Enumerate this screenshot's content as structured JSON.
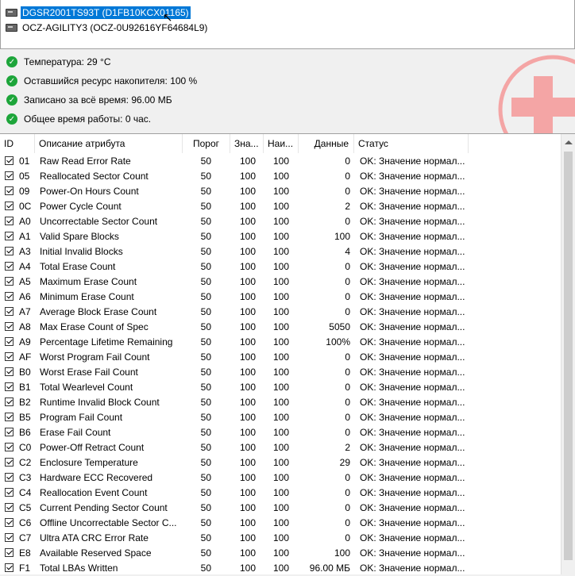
{
  "drives": [
    {
      "label": "DGSR2001TS93T (D1FB10KCX01165)",
      "selected": true
    },
    {
      "label": "OCZ-AGILITY3 (OCZ-0U92616YF64684L9)",
      "selected": false
    }
  ],
  "summary": [
    {
      "label": "Температура: 29 °C"
    },
    {
      "label": "Оставшийся ресурс накопителя: 100 %"
    },
    {
      "label": "Записано за всё время: 96.00 МБ"
    },
    {
      "label": "Общее время работы: 0 час."
    }
  ],
  "table": {
    "columns": {
      "id": "ID",
      "description": "Описание атрибута",
      "threshold": "Порог",
      "value": "Зна...",
      "worst": "Наи...",
      "raw": "Данные",
      "status": "Статус"
    },
    "rows": [
      {
        "id": "01",
        "desc": "Raw Read Error Rate",
        "thr": "50",
        "val": "100",
        "worst": "100",
        "raw": "0",
        "status": "OK: Значение нормал..."
      },
      {
        "id": "05",
        "desc": "Reallocated Sector Count",
        "thr": "50",
        "val": "100",
        "worst": "100",
        "raw": "0",
        "status": "OK: Значение нормал..."
      },
      {
        "id": "09",
        "desc": "Power-On Hours Count",
        "thr": "50",
        "val": "100",
        "worst": "100",
        "raw": "0",
        "status": "OK: Значение нормал..."
      },
      {
        "id": "0C",
        "desc": "Power Cycle Count",
        "thr": "50",
        "val": "100",
        "worst": "100",
        "raw": "2",
        "status": "OK: Значение нормал..."
      },
      {
        "id": "A0",
        "desc": "Uncorrectable Sector Count",
        "thr": "50",
        "val": "100",
        "worst": "100",
        "raw": "0",
        "status": "OK: Значение нормал..."
      },
      {
        "id": "A1",
        "desc": "Valid Spare Blocks",
        "thr": "50",
        "val": "100",
        "worst": "100",
        "raw": "100",
        "status": "OK: Значение нормал..."
      },
      {
        "id": "A3",
        "desc": "Initial Invalid Blocks",
        "thr": "50",
        "val": "100",
        "worst": "100",
        "raw": "4",
        "status": "OK: Значение нормал..."
      },
      {
        "id": "A4",
        "desc": "Total Erase Count",
        "thr": "50",
        "val": "100",
        "worst": "100",
        "raw": "0",
        "status": "OK: Значение нормал..."
      },
      {
        "id": "A5",
        "desc": "Maximum Erase Count",
        "thr": "50",
        "val": "100",
        "worst": "100",
        "raw": "0",
        "status": "OK: Значение нормал..."
      },
      {
        "id": "A6",
        "desc": "Minimum Erase Count",
        "thr": "50",
        "val": "100",
        "worst": "100",
        "raw": "0",
        "status": "OK: Значение нормал..."
      },
      {
        "id": "A7",
        "desc": "Average Block Erase Count",
        "thr": "50",
        "val": "100",
        "worst": "100",
        "raw": "0",
        "status": "OK: Значение нормал..."
      },
      {
        "id": "A8",
        "desc": "Max Erase Count of Spec",
        "thr": "50",
        "val": "100",
        "worst": "100",
        "raw": "5050",
        "status": "OK: Значение нормал..."
      },
      {
        "id": "A9",
        "desc": "Percentage Lifetime Remaining",
        "thr": "50",
        "val": "100",
        "worst": "100",
        "raw": "100%",
        "status": "OK: Значение нормал..."
      },
      {
        "id": "AF",
        "desc": "Worst Program Fail Count",
        "thr": "50",
        "val": "100",
        "worst": "100",
        "raw": "0",
        "status": "OK: Значение нормал..."
      },
      {
        "id": "B0",
        "desc": "Worst Erase Fail Count",
        "thr": "50",
        "val": "100",
        "worst": "100",
        "raw": "0",
        "status": "OK: Значение нормал..."
      },
      {
        "id": "B1",
        "desc": "Total Wearlevel Count",
        "thr": "50",
        "val": "100",
        "worst": "100",
        "raw": "0",
        "status": "OK: Значение нормал..."
      },
      {
        "id": "B2",
        "desc": "Runtime Invalid Block Count",
        "thr": "50",
        "val": "100",
        "worst": "100",
        "raw": "0",
        "status": "OK: Значение нормал..."
      },
      {
        "id": "B5",
        "desc": "Program Fail Count",
        "thr": "50",
        "val": "100",
        "worst": "100",
        "raw": "0",
        "status": "OK: Значение нормал..."
      },
      {
        "id": "B6",
        "desc": "Erase Fail Count",
        "thr": "50",
        "val": "100",
        "worst": "100",
        "raw": "0",
        "status": "OK: Значение нормал..."
      },
      {
        "id": "C0",
        "desc": "Power-Off Retract Count",
        "thr": "50",
        "val": "100",
        "worst": "100",
        "raw": "2",
        "status": "OK: Значение нормал..."
      },
      {
        "id": "C2",
        "desc": "Enclosure Temperature",
        "thr": "50",
        "val": "100",
        "worst": "100",
        "raw": "29",
        "status": "OK: Значение нормал..."
      },
      {
        "id": "C3",
        "desc": "Hardware ECC Recovered",
        "thr": "50",
        "val": "100",
        "worst": "100",
        "raw": "0",
        "status": "OK: Значение нормал..."
      },
      {
        "id": "C4",
        "desc": "Reallocation Event Count",
        "thr": "50",
        "val": "100",
        "worst": "100",
        "raw": "0",
        "status": "OK: Значение нормал..."
      },
      {
        "id": "C5",
        "desc": "Current Pending Sector Count",
        "thr": "50",
        "val": "100",
        "worst": "100",
        "raw": "0",
        "status": "OK: Значение нормал..."
      },
      {
        "id": "C6",
        "desc": "Offline Uncorrectable Sector C...",
        "thr": "50",
        "val": "100",
        "worst": "100",
        "raw": "0",
        "status": "OK: Значение нормал..."
      },
      {
        "id": "C7",
        "desc": "Ultra ATA CRC Error Rate",
        "thr": "50",
        "val": "100",
        "worst": "100",
        "raw": "0",
        "status": "OK: Значение нормал..."
      },
      {
        "id": "E8",
        "desc": "Available Reserved Space",
        "thr": "50",
        "val": "100",
        "worst": "100",
        "raw": "100",
        "status": "OK: Значение нормал..."
      },
      {
        "id": "F1",
        "desc": "Total LBAs Written",
        "thr": "50",
        "val": "100",
        "worst": "100",
        "raw": "96.00 МБ",
        "status": "OK: Значение нормал..."
      }
    ]
  },
  "colors": {
    "ok_green": "#1da53a",
    "selection_blue": "#0078d7",
    "health_decor": "#f4a5a5"
  }
}
